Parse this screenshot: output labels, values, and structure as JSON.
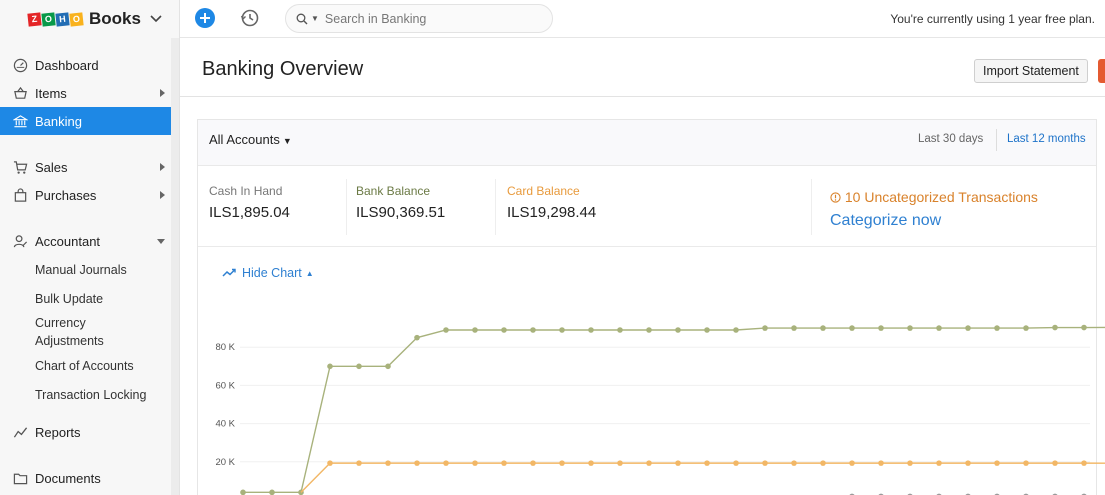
{
  "app": {
    "brand_letters": [
      "Z",
      "O",
      "H",
      "O"
    ],
    "brand_name": "Books"
  },
  "topbar": {
    "search_placeholder": "Search in Banking",
    "plan_text": "You're currently using 1 year free plan."
  },
  "sidebar": {
    "items": [
      {
        "label": "Dashboard",
        "icon": "dashboard-icon"
      },
      {
        "label": "Items",
        "icon": "basket-icon"
      },
      {
        "label": "Banking",
        "icon": "bank-icon"
      },
      {
        "label": "Sales",
        "icon": "cart-icon"
      },
      {
        "label": "Purchases",
        "icon": "bag-icon"
      },
      {
        "label": "Accountant",
        "icon": "accountant-icon"
      },
      {
        "label": "Reports",
        "icon": "reports-icon"
      },
      {
        "label": "Documents",
        "icon": "documents-icon"
      }
    ],
    "accountant_subitems": [
      "Manual Journals",
      "Bulk Update",
      "Currency Adjustments",
      "Chart of Accounts",
      "Transaction Locking"
    ]
  },
  "page": {
    "title": "Banking Overview",
    "import_label": "Import Statement",
    "account_filter": "All Accounts",
    "range_30": "Last 30 days",
    "range_12": "Last 12 months"
  },
  "stats": {
    "cash": {
      "label": "Cash In Hand",
      "value": "ILS1,895.04"
    },
    "bank": {
      "label": "Bank Balance",
      "value": "ILS90,369.51"
    },
    "card": {
      "label": "Card Balance",
      "value": "ILS19,298.44"
    },
    "uncategorized": "10 Uncategorized Transactions",
    "categorize_link": "Categorize now"
  },
  "chart_toggle": "Hide Chart",
  "colors": {
    "accent": "#1e88e5",
    "bank_series": "#a8b27c",
    "card_series": "#f2b766",
    "cash_series": "#9a9a9a"
  },
  "chart_data": {
    "type": "line",
    "y_ticks": [
      "20 K",
      "40 K",
      "60 K",
      "80 K"
    ],
    "ylim": [
      0,
      100000
    ],
    "series": [
      {
        "name": "Bank Balance",
        "color": "#a8b27c",
        "values": [
          4000,
          4000,
          4000,
          70000,
          70000,
          70000,
          85000,
          89000,
          89000,
          89000,
          89000,
          89000,
          89000,
          89000,
          89000,
          89000,
          89000,
          89000,
          90000,
          90000,
          90000,
          90000,
          90000,
          90000,
          90000,
          90000,
          90000,
          90000,
          90300,
          90300,
          90369
        ]
      },
      {
        "name": "Card Balance",
        "color": "#f2b766",
        "values": [
          null,
          null,
          null,
          19300,
          19300,
          19300,
          19300,
          19300,
          19300,
          19300,
          19300,
          19300,
          19300,
          19300,
          19300,
          19300,
          19300,
          19300,
          19300,
          19300,
          19300,
          19300,
          19300,
          19300,
          19300,
          19300,
          19300,
          19300,
          19300,
          19300,
          19298
        ]
      },
      {
        "name": "Cash In Hand",
        "color": "#9a9a9a",
        "values": [
          null,
          null,
          null,
          null,
          null,
          null,
          null,
          null,
          null,
          null,
          null,
          null,
          null,
          null,
          null,
          null,
          null,
          null,
          null,
          null,
          null,
          1895,
          1895,
          1895,
          1895,
          1895,
          1895,
          1895,
          1895,
          1895,
          1895
        ]
      }
    ]
  }
}
